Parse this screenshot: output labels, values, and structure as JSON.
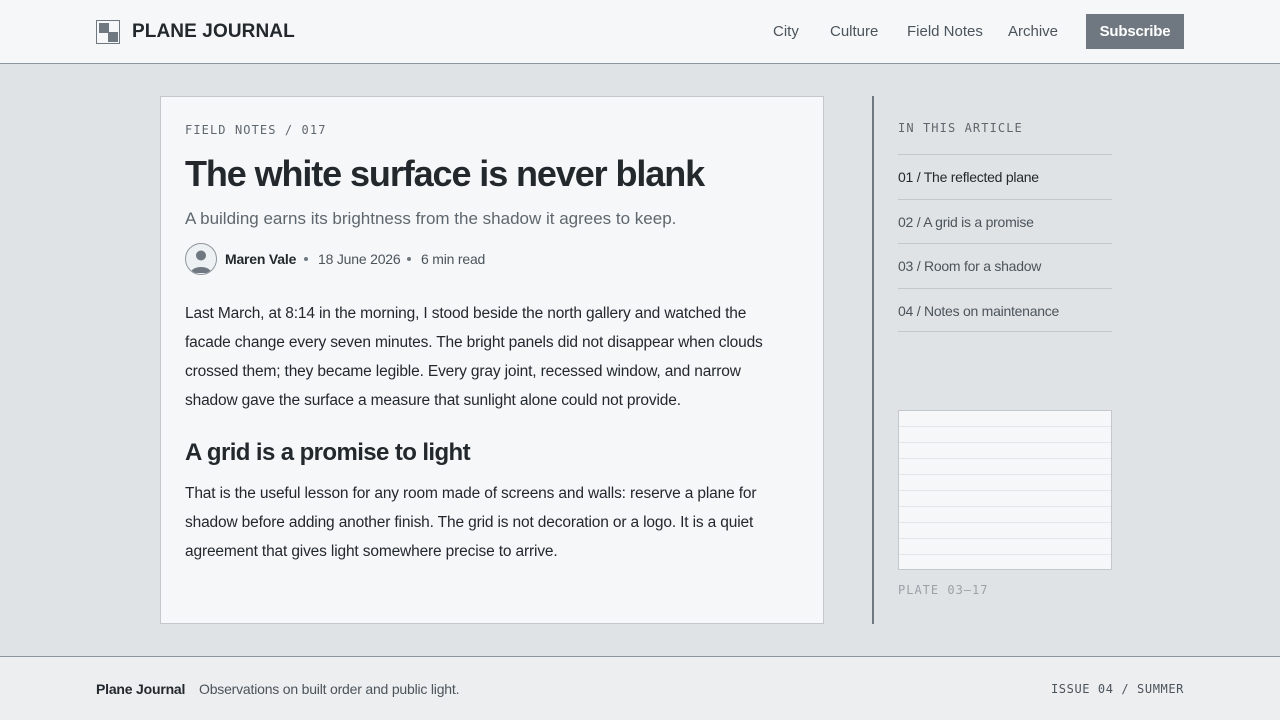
{
  "header": {
    "brand": "PLANE JOURNAL",
    "logo_icon": "split-square-logo-icon",
    "nav": [
      "City",
      "Culture",
      "Field Notes",
      "Archive"
    ],
    "subscribe_label": "Subscribe"
  },
  "article": {
    "kicker": "FIELD NOTES / 017",
    "title": "The white surface is never blank",
    "deck": "A building earns its brightness from the shadow it agrees to keep.",
    "author": {
      "name": "Maren Vale",
      "avatar_icon": "user-avatar-icon"
    },
    "date": "18 June 2026",
    "read_time": "6 min read",
    "paragraphs": [
      "Last March, at 8:14 in the morning, I stood beside the north gallery and watched the facade change every seven minutes. The bright panels did not disappear when clouds crossed them; they became legible. Every gray joint, recessed window, and narrow shadow gave the surface a measure that sunlight alone could not provide.",
      "That is the useful lesson for any room made of screens and walls: reserve a plane for shadow before adding another finish. The grid is not decoration or a logo. It is a quiet agreement that gives light somewhere precise to arrive."
    ],
    "subheading": "A grid is a promise to light"
  },
  "sidebar": {
    "toc_heading": "IN THIS ARTICLE",
    "toc_items": [
      "01 / The reflected plane",
      "02 / A grid is a promise",
      "03 / Room for a shadow",
      "04 / Notes on maintenance"
    ],
    "active_index": 0,
    "plate_caption": "PLATE 03–17"
  },
  "footer": {
    "brand": "Plane Journal",
    "tagline": "Observations on built order and public light.",
    "issue": "ISSUE 04 / SUMMER"
  },
  "colors": {
    "page_bg": "#dfe3e6",
    "surface": "#f5f7f9",
    "ink": "#23282d",
    "accent_gray": "#6f7880",
    "muted": "#5f676e"
  }
}
